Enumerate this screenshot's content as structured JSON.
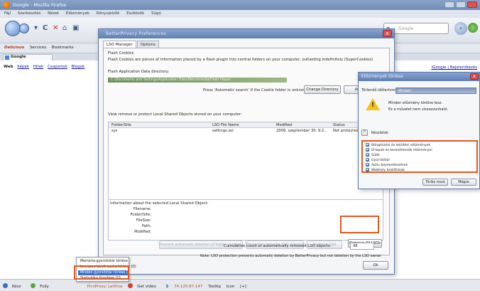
{
  "browser": {
    "title": "Google - Mozilla Firefox",
    "menu": [
      "Fájl",
      "Szerkesztés",
      "Nézet",
      "Előzmények",
      "Könyvjelzők",
      "Eszközök",
      "Súgó"
    ],
    "search_placeholder": "Google",
    "search_engine_glyph": "g",
    "search_go_glyph": "⌕",
    "bookmarks": {
      "brand": "Delicious",
      "services": "Services",
      "link1": "Bookmarks"
    },
    "tab_title": "Google"
  },
  "page": {
    "gbar_bold": "Web",
    "gbar_links": [
      "Képek",
      "Hírek",
      "Csoportok",
      "Blogok"
    ],
    "right_links": "iGoogle | Bejelentkezés"
  },
  "better_privacy": {
    "title": "BetterPrivacy Preferences",
    "close_glyph": "x",
    "tabs": [
      "LSO Manager",
      "Options"
    ],
    "flash_cookies_heading": "Flash Cookies",
    "flash_cookies_desc": "Flash Cookies are pieces of information placed by a flash plugin into central folders on your computer, outlasting indefinitely (SuperCookies)",
    "flash_dir_label": "Flash Application Data directory:",
    "flash_dir_value": "C:\\Documents and Settings\\Application Data\\Macromedia\\Flash Player",
    "auto_search_hint": "Press 'Automatic search' if the Cookie folder is unknown.",
    "change_dir_button": "Change Directory",
    "auto_search_button": "Automatic",
    "list_intro": "View remove or protect Local Shared Objects stored on your computer:",
    "columns": [
      "Folder/Site",
      "LSO File Name",
      "Modified",
      "Status"
    ],
    "rows": [
      {
        "site": "sys",
        "file": "settings.sol",
        "modified": "2009. szeptember 30. 9:2...",
        "status": "Not protected"
      }
    ],
    "info_heading": "Information about the selected Local Shared Object:",
    "info_labels": [
      "Filename:",
      "Folder/Site:",
      "FileSize:",
      "Path:",
      "Modified:"
    ],
    "action_buttons": [
      "Prevent automatic deletion of folder contents",
      "Prevent automatic LSO deletion",
      "Remove LSO"
    ],
    "remove_all_button": "Remove All LSOs",
    "note": "Note: LSO protection prevents automatic deletion by BetterPrivacy but not deletion by the LSO owner",
    "count_label": "Cumulative count of automatically removed LSO objects:",
    "count_value": "98",
    "ok_button": "Ok"
  },
  "clear_history": {
    "title": "Előzmények törlése",
    "close_glyph": "x",
    "range_label": "Törlendő időtartomány:",
    "range_value": "Minden",
    "warning_line1": "Minden előzmény törölve lesz.",
    "warning_line2": "Ez a művelet nem visszavonható.",
    "details_label": "Részletek",
    "items": [
      "Böngészési és letöltési előzmények",
      "Űrlapok és keresőmezők előzményei",
      "Sütik",
      "Gyorsítótár",
      "Aktív bejelentkezések",
      "Webhely beállítások"
    ],
    "clear_button": "Törlés most",
    "cancel_button": "Mégse"
  },
  "context_menu": {
    "items": [
      "Memória-gyorsítótár törlése",
      "Lemezen tárolt cache törlése (D)",
      "Minden gyorsítótár törlése (A)",
      "Statisztika frissítése (U)"
    ],
    "selected_index": 2
  },
  "statusbar": {
    "items": [
      "Kész",
      "Fully",
      "PicoProxy: Letiltva",
      "Get video",
      "S",
      "74.125.87.147",
      "Tooltip",
      "Icon",
      "[+]"
    ]
  },
  "colors": {
    "highlight": "#e2571e",
    "dialog_title": "#5e7db2",
    "link": "#1a0dab"
  }
}
